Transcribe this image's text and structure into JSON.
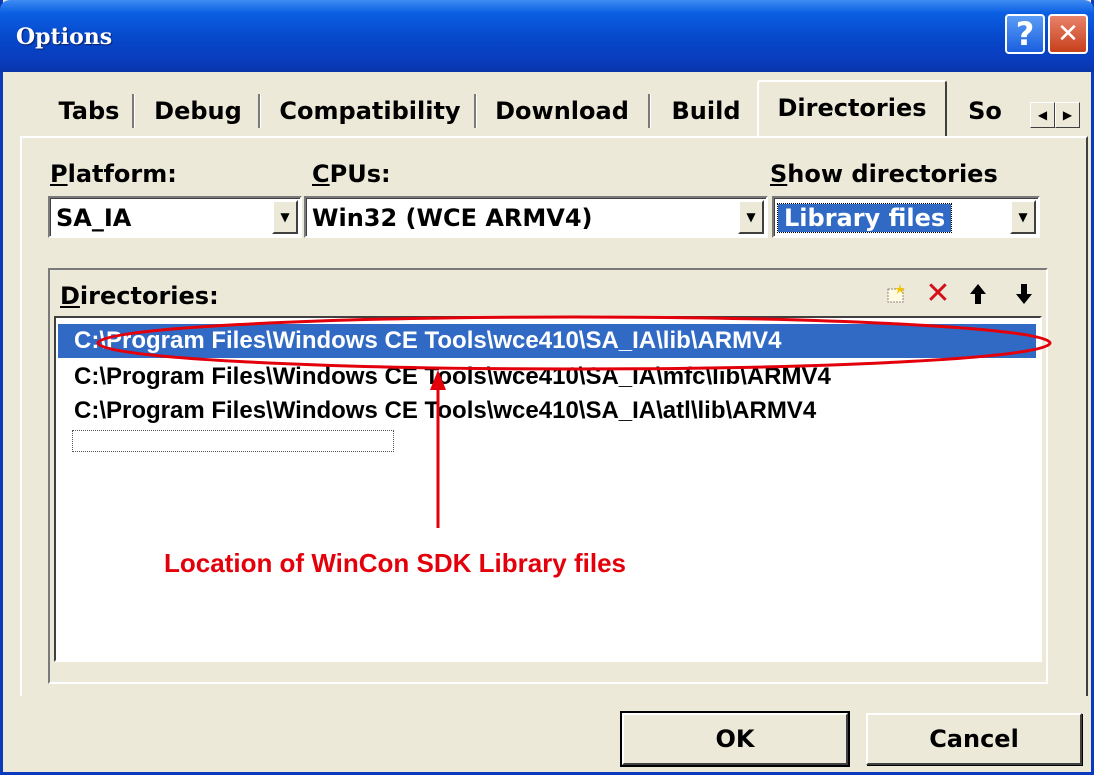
{
  "window": {
    "title": "Options",
    "help_symbol": "?",
    "close_symbol": "✕"
  },
  "tabs": [
    {
      "label": "Tabs",
      "active": false
    },
    {
      "label": "Debug",
      "active": false
    },
    {
      "label": "Compatibility",
      "active": false
    },
    {
      "label": "Download",
      "active": false
    },
    {
      "label": "Build",
      "active": false
    },
    {
      "label": "Directories",
      "active": true
    },
    {
      "label": "So",
      "active": false
    }
  ],
  "fields": {
    "platform": {
      "label": "Platform:",
      "mnemonic": "P",
      "rest": "latform:",
      "value": "SA_IA"
    },
    "cpus": {
      "label": "CPUs:",
      "mnemonic": "C",
      "rest": "PUs:",
      "value": "Win32 (WCE ARMV4)"
    },
    "show_directories": {
      "label": "Show directories",
      "mnemonic": "S",
      "rest": "how directories",
      "value": "Library files"
    }
  },
  "directories": {
    "label": "Directories:",
    "mnemonic": "D",
    "rest": "irectories:",
    "items": [
      "C:\\Program Files\\Windows CE Tools\\wce410\\SA_IA\\lib\\ARMV4",
      "C:\\Program Files\\Windows CE Tools\\wce410\\SA_IA\\mfc\\lib\\ARMV4",
      "C:\\Program Files\\Windows CE Tools\\wce410\\SA_IA\\atl\\lib\\ARMV4"
    ],
    "selected_index": 0
  },
  "buttons": {
    "ok": "OK",
    "cancel": "Cancel"
  },
  "annotation": {
    "text": "Location of WinCon SDK Library files",
    "color": "#e3000b"
  },
  "colors": {
    "title_bar": "#0a3bbd",
    "dialog_bg": "#ece9d8",
    "selection": "#316ac5"
  },
  "icons": [
    "help-icon",
    "close-icon",
    "new-folder-icon",
    "delete-icon",
    "move-up-icon",
    "move-down-icon",
    "tab-scroll-left-icon",
    "tab-scroll-right-icon",
    "dropdown-arrow-icon"
  ]
}
